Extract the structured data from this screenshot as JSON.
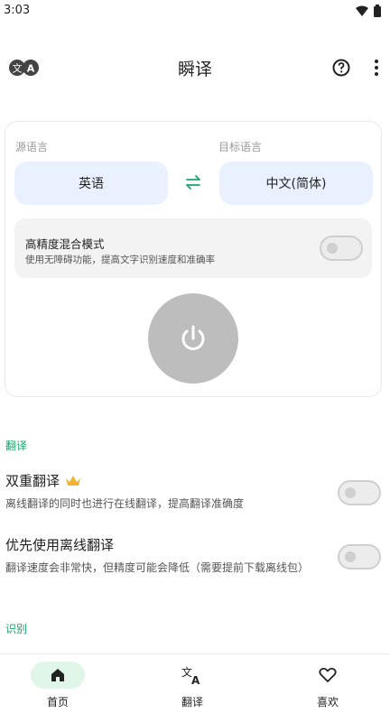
{
  "status_bar": {
    "time": "3:03"
  },
  "app_bar": {
    "title": "瞬译"
  },
  "card": {
    "source_label": "源语言",
    "target_label": "目标语言",
    "source_language": "英语",
    "target_language": "中文(简体)",
    "mode_title": "高精度混合模式",
    "mode_desc": "使用无障碍功能，提高文字识别速度和准确率",
    "mode_enabled": false
  },
  "sections": {
    "translate_header": "翻译",
    "recognize_header": "识别"
  },
  "settings": [
    {
      "title": "双重翻译",
      "desc": "离线翻译的同时也进行在线翻译，提高翻译准确度",
      "enabled": false,
      "premium": true
    },
    {
      "title": "优先使用离线翻译",
      "desc": "翻译速度会非常快，但精度可能会降低（需要提前下载离线包）",
      "enabled": false,
      "premium": false
    }
  ],
  "bottom_nav": [
    {
      "label": "首页",
      "icon": "home-icon",
      "active": true
    },
    {
      "label": "翻译",
      "icon": "translate-icon",
      "active": false
    },
    {
      "label": "喜欢",
      "icon": "heart-icon",
      "active": false
    }
  ],
  "colors": {
    "accent": "#1aa46c",
    "lang_button_bg": "#e8f1fd",
    "power_button": "#bdbdbd"
  }
}
